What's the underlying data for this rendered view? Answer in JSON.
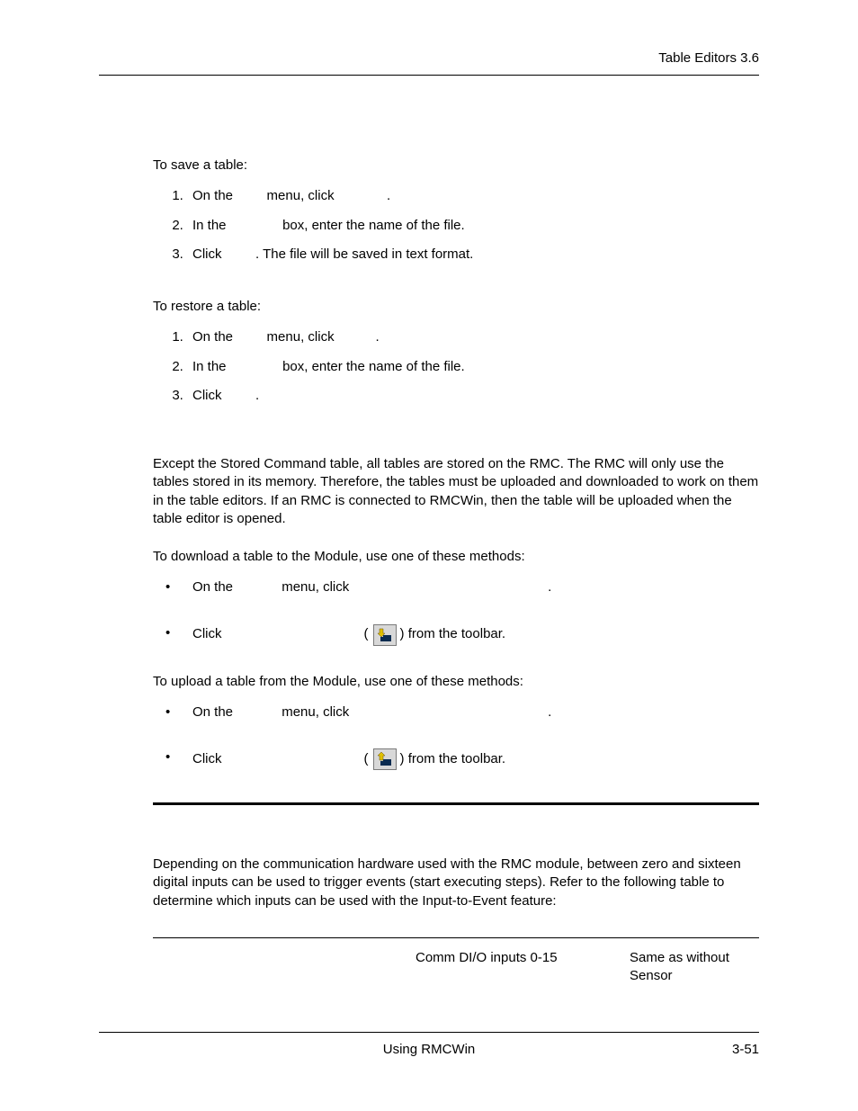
{
  "header": {
    "title": "Table Editors  3.6"
  },
  "save": {
    "intro": "To save a table:",
    "item1_a": "On the ",
    "item1_b": " menu, click ",
    "item1_c": ".",
    "item2_a": "In the ",
    "item2_b": " box, enter the name of the file.",
    "item3_a": "Click ",
    "item3_b": ". The file will be saved in text format."
  },
  "restore": {
    "intro": "To restore a table:",
    "item1_a": "On the ",
    "item1_b": " menu, click ",
    "item1_c": ".",
    "item2_a": "In the ",
    "item2_b": " box, enter the name of the file.",
    "item3_a": "Click ",
    "item3_b": "."
  },
  "main_paragraph": "Except the Stored Command table, all tables are stored on the RMC. The RMC will only use the tables stored in its memory. Therefore, the tables must be uploaded and downloaded to work on them in the table editors. If an RMC is connected to RMCWin, then the table will be uploaded when the table editor is opened.",
  "download": {
    "intro": "To download a table to the Module, use one of these methods:",
    "b1_a": "On the ",
    "b1_b": " menu, click ",
    "b1_c": ".",
    "b2_a": "Click ",
    "b2_b": "(",
    "b2_c": ") from the toolbar."
  },
  "upload": {
    "intro": "To upload a table from the Module, use one of these methods:",
    "b1_a": "On the ",
    "b1_b": " menu, click ",
    "b1_c": ".",
    "b2_a": "Click ",
    "b2_b": "(",
    "b2_c": ") from the toolbar."
  },
  "events_paragraph": "Depending on the communication hardware used with the RMC module, between zero and sixteen digital inputs can be used to trigger events (start executing steps). Refer to the following table to determine which inputs can be used with the Input-to-Event feature:",
  "table": {
    "c2": "Comm DI/O inputs 0-15",
    "c3": "Same as without Sensor"
  },
  "footer": {
    "center": "Using RMCWin",
    "right": "3-51"
  }
}
